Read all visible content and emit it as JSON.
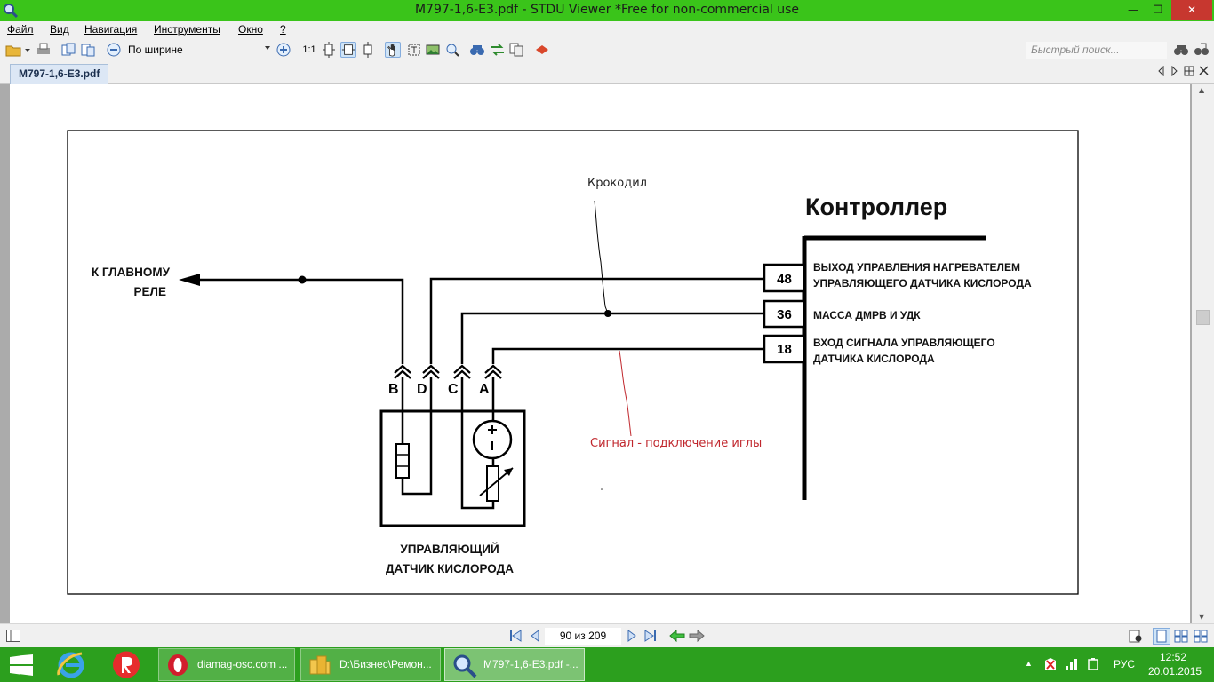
{
  "window": {
    "title": "M797-1,6-E3.pdf - STDU Viewer *Free for non-commercial use",
    "min_glyph": "—",
    "max_glyph": "❐",
    "close_glyph": "✕"
  },
  "menu": {
    "file": "Файл",
    "view": "Вид",
    "navigation": "Навигация",
    "tools": "Инструменты",
    "window": "Окно",
    "help": "?"
  },
  "toolbar": {
    "zoom_mode": "По ширине",
    "actual_size": "1:1",
    "search_placeholder": "Быстрый поиск..."
  },
  "tabs": [
    {
      "label": "M797-1,6-E3.pdf"
    }
  ],
  "diagram": {
    "crocodile": "Крокодил",
    "controller": "Контроллер",
    "main_relay_1": "К ГЛАВНОМУ",
    "main_relay_2": "РЕЛЕ",
    "pin_48": "48",
    "pin_36": "36",
    "pin_18": "18",
    "desc_48_1": "ВЫХОД УПРАВЛЕНИЯ НАГРЕВАТЕЛЕМ",
    "desc_48_2": "УПРАВЛЯЮЩЕГО ДАТЧИКА КИСЛОРОДА",
    "desc_36": "МАССА ДМРВ И УДК",
    "desc_18_1": "ВХОД СИГНАЛА УПРАВЛЯЮЩЕГО",
    "desc_18_2": "ДАТЧИКА КИСЛОРОДА",
    "conn_b": "B",
    "conn_d": "D",
    "conn_c": "C",
    "conn_a": "A",
    "signal_note": "Сигнал - подключение иглы",
    "sensor_1": "УПРАВЛЯЮЩИЙ",
    "sensor_2": "ДАТЧИК КИСЛОРОДА",
    "red_color": "#c0272d"
  },
  "status": {
    "page_indicator": "90 из 209"
  },
  "taskbar": {
    "items": [
      {
        "label": "diamag-osc.com ..."
      },
      {
        "label": "D:\\Бизнес\\Ремон..."
      },
      {
        "label": "M797-1,6-E3.pdf -..."
      }
    ],
    "language": "РУС",
    "time": "12:52",
    "date": "20.01.2015"
  }
}
